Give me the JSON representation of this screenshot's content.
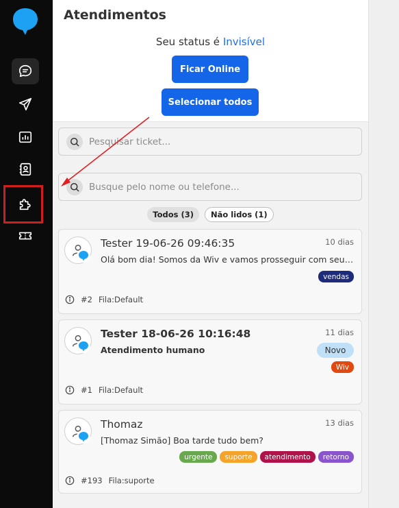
{
  "sidebar": {
    "items": [
      {
        "name": "chat-icon",
        "active": true
      },
      {
        "name": "send-icon",
        "active": false
      },
      {
        "name": "dashboard-icon",
        "active": false
      },
      {
        "name": "contacts-icon",
        "active": false
      },
      {
        "name": "puzzle-icon",
        "active": false
      },
      {
        "name": "ticket-icon",
        "active": false
      }
    ]
  },
  "header": {
    "title": "Atendimentos",
    "status_prefix": "Seu status é",
    "status_value": "Invisível",
    "online_button": "Ficar Online",
    "select_all_button": "Selecionar todos"
  },
  "search": {
    "ticket_placeholder": "Pesquisar ticket...",
    "contact_placeholder": "Busque pelo nome ou telefone..."
  },
  "filters": {
    "all": "Todos (3)",
    "unread": "Não lidos (1)"
  },
  "tickets": [
    {
      "name": "Tester 19-06-26 09:46:35",
      "time": "10 dias",
      "message": "Olá bom dia! Somos da Wiv e vamos prosseguir com seu atendimento",
      "tags": [
        {
          "label": "vendas",
          "color": "#1e2a7a"
        }
      ],
      "id": "#2",
      "queue": "Fila:Default"
    },
    {
      "name": "Tester 18-06-26 10:16:48",
      "time": "11 dias",
      "message": "Atendimento humano",
      "novo": "Novo",
      "tags": [
        {
          "label": "Wiv",
          "color": "#e04a10"
        }
      ],
      "id": "#1",
      "queue": "Fila:Default"
    },
    {
      "name": "Thomaz",
      "time": "13 dias",
      "message": "[Thomaz Simão] Boa tarde tudo bem?",
      "tags": [
        {
          "label": "urgente",
          "color": "#6aa84f"
        },
        {
          "label": "suporte",
          "color": "#f4a32b"
        },
        {
          "label": "atendimento",
          "color": "#b0124a"
        },
        {
          "label": "retorno",
          "color": "#8a55cc"
        }
      ],
      "id": "#193",
      "queue": "Fila:suporte"
    }
  ],
  "colors": {
    "accent": "#1565e8",
    "status_text": "#1e6fe6",
    "highlight": "#d01d1d",
    "arrow": "#e02020"
  }
}
